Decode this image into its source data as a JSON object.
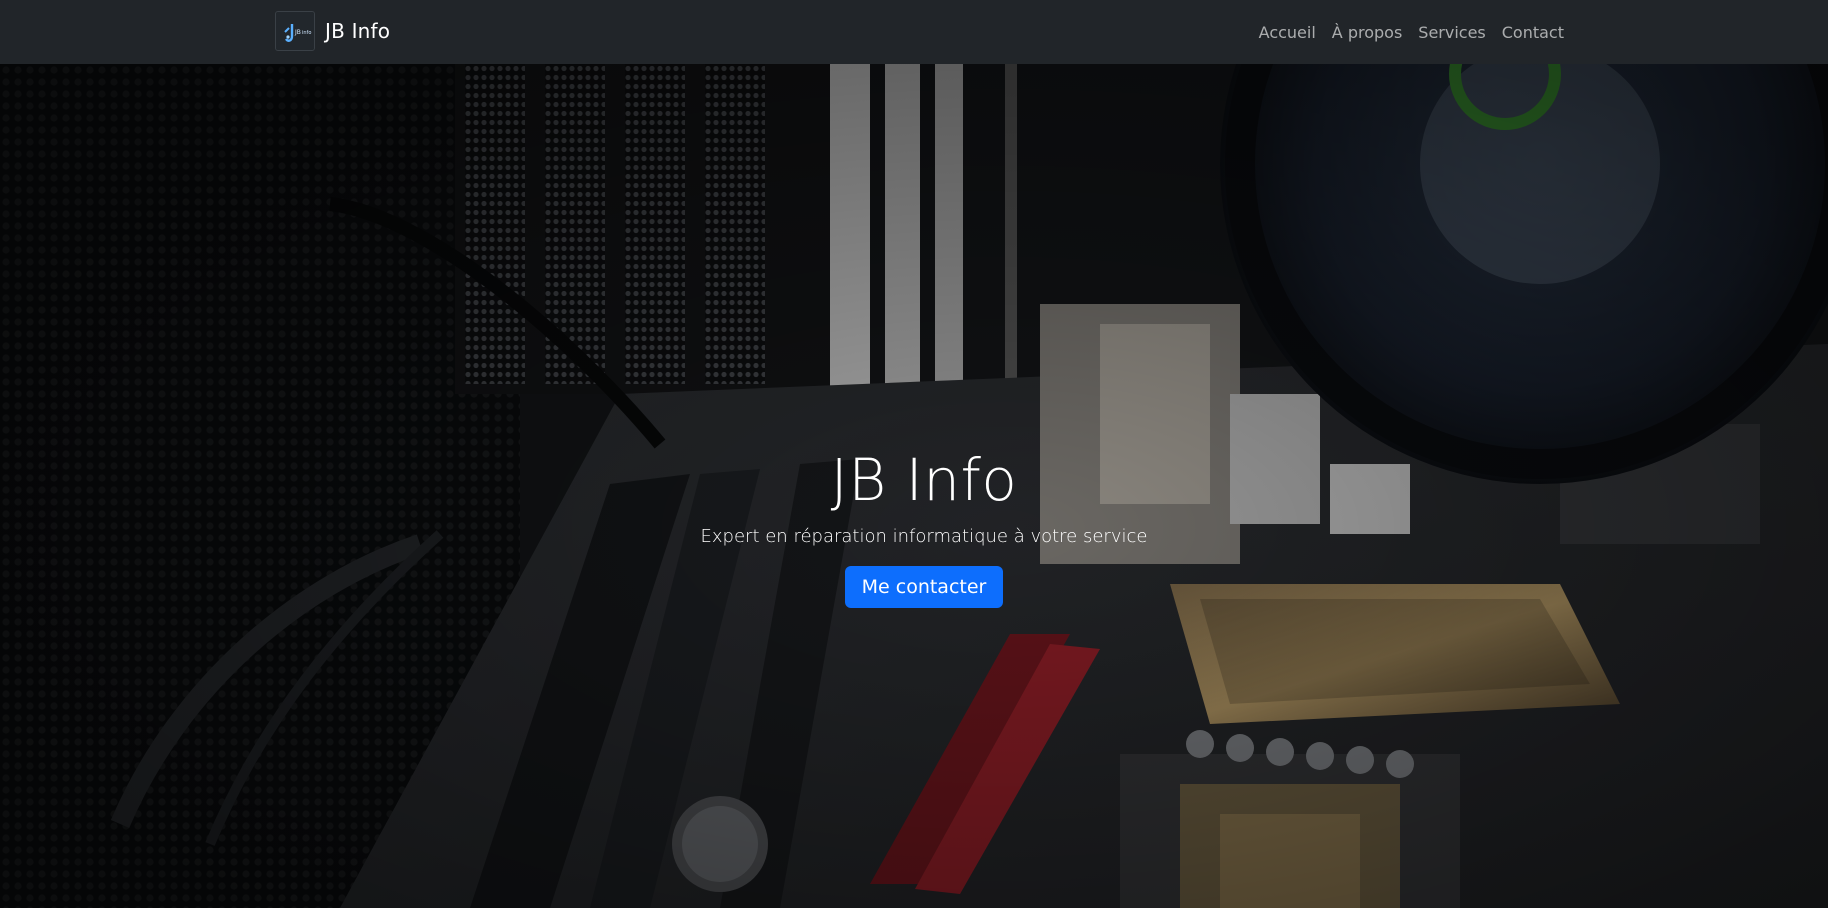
{
  "navbar": {
    "brand_name": "JB Info",
    "logo_text": "JB Info",
    "links": [
      "Accueil",
      "À propos",
      "Services",
      "Contact"
    ]
  },
  "hero": {
    "title": "JB Info",
    "subtitle": "Expert en réparation informatique à votre service",
    "cta_label": "Me contacter",
    "background": "photo-interior-pc-motherboard"
  },
  "colors": {
    "navbar_bg": "#212529",
    "accent": "#0d6efd",
    "text": "#ffffff"
  }
}
